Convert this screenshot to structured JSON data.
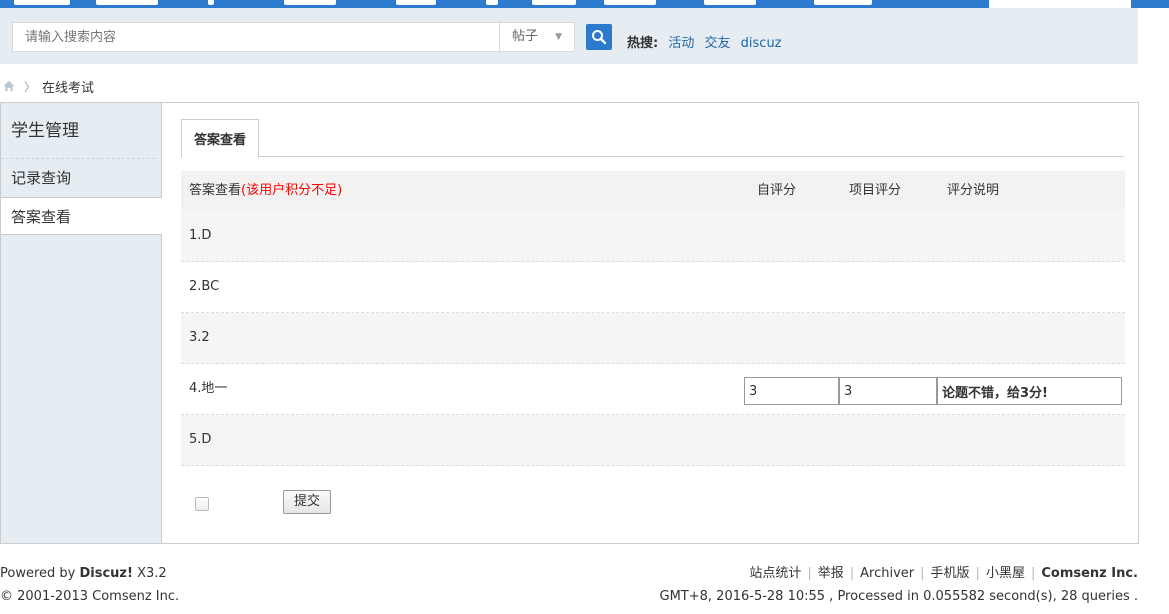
{
  "search": {
    "placeholder": "请输入搜索内容",
    "type": "帖子",
    "hot_label": "热搜:",
    "hot_links": [
      "活动",
      "交友",
      "discuz"
    ]
  },
  "breadcrumb": {
    "current": "在线考试"
  },
  "sidebar": {
    "title": "学生管理",
    "items": [
      {
        "label": "记录查询"
      },
      {
        "label": "答案查看"
      }
    ]
  },
  "tab": {
    "label": "答案查看"
  },
  "table": {
    "headers": {
      "answer": "答案查看",
      "warning": "(该用户积分不足)",
      "self_score": "自评分",
      "item_score": "项目评分",
      "score_note": "评分说明"
    },
    "rows": [
      {
        "q": "1.D"
      },
      {
        "q": "2.BC"
      },
      {
        "q": "3.2"
      },
      {
        "q": "4.地一",
        "self_score": "3",
        "item_score": "3",
        "note": "论题不错，给3分!"
      },
      {
        "q": "5.D"
      }
    ]
  },
  "submit_label": "提交",
  "footer": {
    "powered_prefix": "Powered by ",
    "powered_brand": "Discuz!",
    "powered_version": " X3.2",
    "copyright": "© 2001-2013 Comsenz Inc.",
    "links": [
      "站点统计",
      "举报",
      "Archiver",
      "手机版",
      "小黑屋"
    ],
    "company": "Comsenz Inc.",
    "stats": "GMT+8, 2016-5-28 10:55 , Processed in 0.055582 second(s), 28 queries ."
  },
  "colors": {
    "brand": "#2b7acd",
    "panel": "#e5edf2",
    "warning": "#ff0000"
  }
}
